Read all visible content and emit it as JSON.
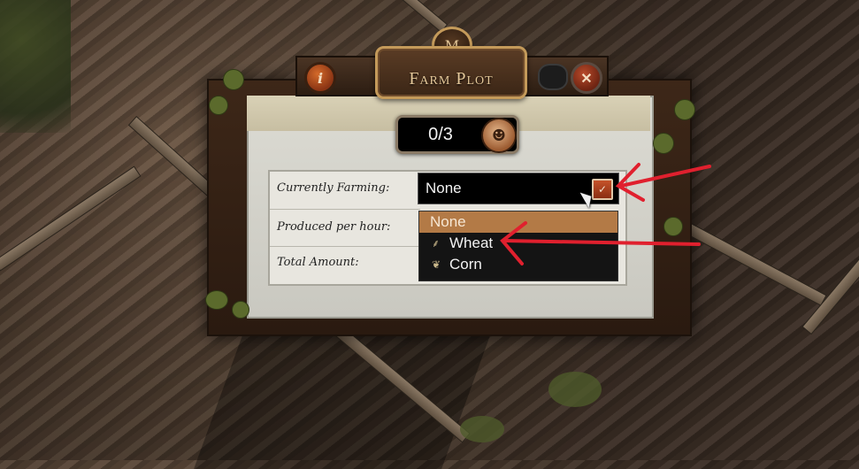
{
  "window": {
    "title": "Farm Plot"
  },
  "header": {
    "info_glyph": "i",
    "close_glyph": "✕",
    "crest_glyph": "M"
  },
  "counter": {
    "text": "0/3",
    "icon": "worker-icon"
  },
  "info": {
    "currently_farming_label": "Currently Farming:",
    "produced_per_hour_label": "Produced per hour:",
    "total_amount_label": "Total Amount:"
  },
  "dropdown": {
    "selected": "None",
    "options": [
      {
        "label": "None",
        "icon": ""
      },
      {
        "label": "Wheat",
        "icon": "wheat-icon"
      },
      {
        "label": "Corn",
        "icon": "corn-icon"
      }
    ],
    "highlighted_index": 0
  },
  "icons": {
    "wheat": "⸙",
    "corn": "❦",
    "worker": "☻",
    "chevron": "✓"
  },
  "colors": {
    "highlight": "#b37a46",
    "annotation_red": "#e0202e",
    "button_orange": "#c5522a"
  }
}
